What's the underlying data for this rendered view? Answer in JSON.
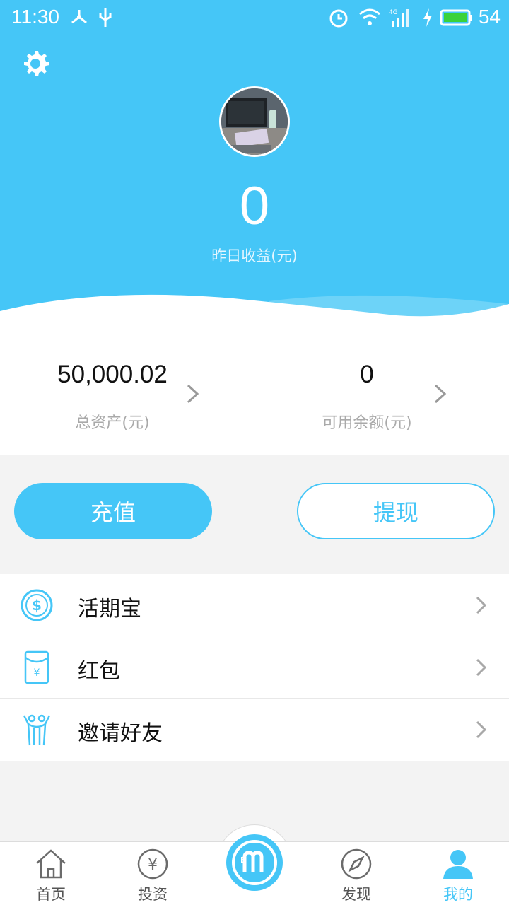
{
  "status_bar": {
    "time": "11:30",
    "battery": "54",
    "network": "4G"
  },
  "header": {
    "settings_icon": "gear-icon",
    "yesterday_earnings": "0",
    "yesterday_earnings_label": "昨日收益(元)"
  },
  "assets": {
    "total_value": "50,000.02",
    "total_label": "总资产(元)",
    "available_value": "0",
    "available_label": "可用余额(元)"
  },
  "actions": {
    "recharge_label": "充值",
    "withdraw_label": "提现"
  },
  "menu": {
    "items": [
      {
        "label": "活期宝",
        "icon": "coin-icon"
      },
      {
        "label": "红包",
        "icon": "red-packet-icon"
      },
      {
        "label": "邀请好友",
        "icon": "invite-friends-icon"
      }
    ]
  },
  "tabbar": {
    "items": [
      {
        "label": "首页",
        "icon": "home-icon"
      },
      {
        "label": "投资",
        "icon": "yen-circle-icon"
      },
      {
        "label": "",
        "icon": "bm-logo-icon"
      },
      {
        "label": "发现",
        "icon": "compass-icon"
      },
      {
        "label": "我的",
        "icon": "user-icon",
        "active": true
      }
    ]
  },
  "colors": {
    "accent": "#45c6f7",
    "background": "#f3f3f3"
  }
}
